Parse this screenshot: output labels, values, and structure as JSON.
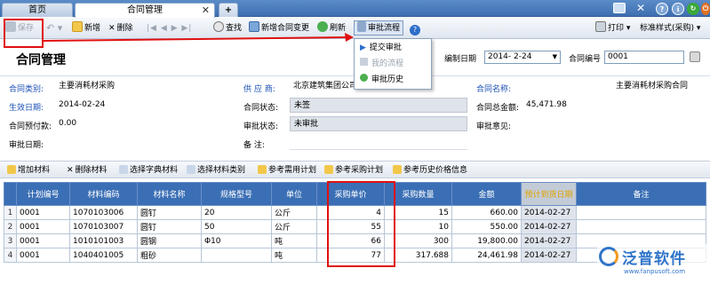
{
  "tabs": {
    "home": "首页",
    "active": "合同管理",
    "new_tab": "+"
  },
  "window_buttons": [
    "?",
    "ℹ",
    "↻",
    "⏻"
  ],
  "toolbar": {
    "save": "保存",
    "undo": "↶",
    "add": "新增",
    "delete": "删除",
    "nav": "|◀ ◀ ▶ ▶|",
    "find": "查找",
    "change": "新增合同变更",
    "refresh": "刷新",
    "approve": "审批流程",
    "print": "打印",
    "style": "标准样式(采购)"
  },
  "approve_menu": {
    "items": [
      "提交审批",
      "我的流程",
      "审批历史"
    ]
  },
  "header": {
    "title": "合同管理",
    "date_label": "编制日期",
    "date_value": "2014- 2-24",
    "contract_no_label": "合同编号",
    "contract_no_value": "0001"
  },
  "info": {
    "contract_type_label": "合同类别:",
    "contract_type": "主要消耗材采购",
    "supplier_label": "供 应 商:",
    "supplier": "北京建筑集团公司",
    "contract_name_label": "合同名称:",
    "contract_name": "主要消耗材采购合同",
    "effective_label": "生效日期:",
    "effective": "2014-02-24",
    "status_label": "合同状态:",
    "status": "未签",
    "total_label": "合同总金额:",
    "total": "45,471.98",
    "prepay_label": "合同预付款:",
    "prepay": "0.00",
    "approve_status_label": "审批状态:",
    "approve_status": "未审批",
    "opinion_label": "审批意见:",
    "approve_date_label": "审批日期:",
    "remark_label": "备    注:"
  },
  "detail_toolbar": [
    "增加材料",
    "删除材料",
    "选择字典材料",
    "选择材料类别",
    "参考需用计划",
    "参考采购计划",
    "参考历史价格信息"
  ],
  "table": {
    "headers": [
      "计划编号",
      "材料编码",
      "材料名称",
      "规格型号",
      "单位",
      "采购单价",
      "采购数量",
      "金额",
      "预计到货日期",
      "备注"
    ],
    "rows": [
      {
        "n": "1",
        "plan": "0001",
        "code": "1070103006",
        "name": "圆钉",
        "spec": "20",
        "unit": "公斤",
        "price": "4",
        "qty": "15",
        "amount": "660.00",
        "date": "2014-02-27",
        "note": ""
      },
      {
        "n": "2",
        "plan": "0001",
        "code": "1070103007",
        "name": "圆钉",
        "spec": "50",
        "unit": "公斤",
        "price": "55",
        "qty": "10",
        "amount": "550.00",
        "date": "2014-02-27",
        "note": ""
      },
      {
        "n": "3",
        "plan": "0001",
        "code": "1010101003",
        "name": "圆钢",
        "spec": "Φ10",
        "unit": "吨",
        "price": "66",
        "qty": "300",
        "amount": "19,800.00",
        "date": "2014-02-27",
        "note": ""
      },
      {
        "n": "4",
        "plan": "0001",
        "code": "1040401005",
        "name": "粗砂",
        "spec": "",
        "unit": "吨",
        "price": "77",
        "qty": "317.688",
        "amount": "24,461.98",
        "date": "2014-02-27",
        "note": ""
      }
    ]
  },
  "logo": {
    "name": "泛普软件",
    "url": "www.fanpusoft.com"
  },
  "colors": {
    "accent": "#3b6fb5",
    "highlight": "#e01010"
  }
}
